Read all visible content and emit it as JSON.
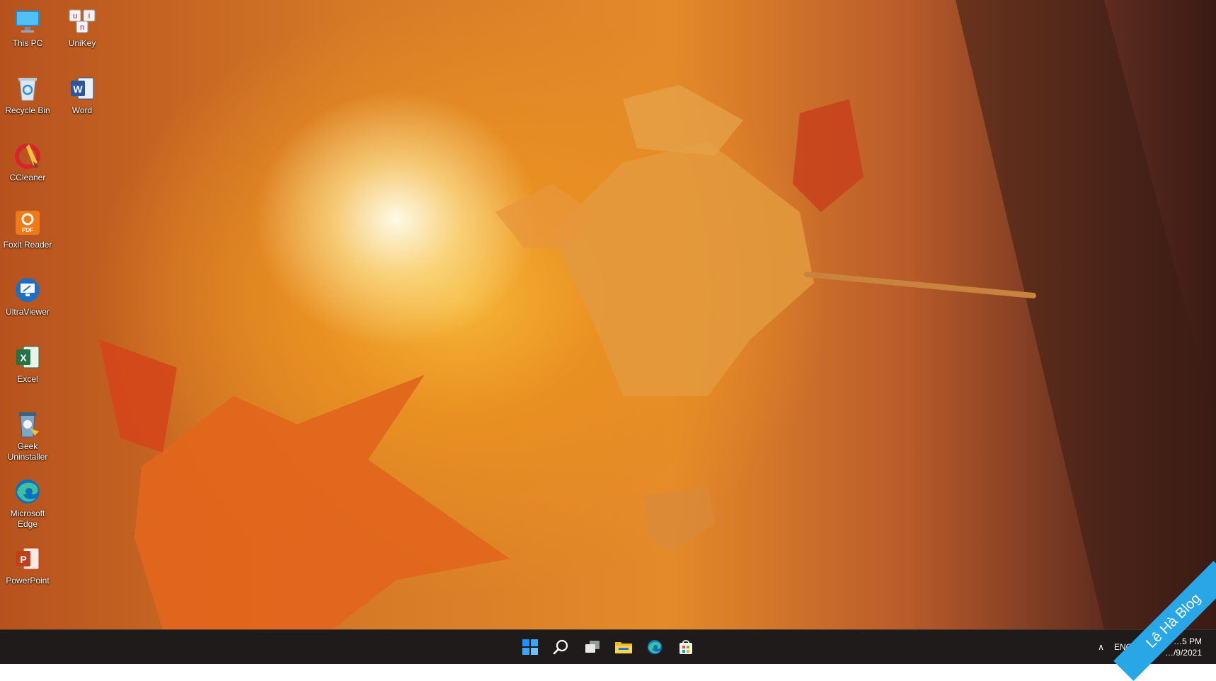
{
  "desktop": {
    "icons": [
      {
        "label": "This PC",
        "icon": "monitor-icon"
      },
      {
        "label": "UniKey",
        "icon": "unikey-icon"
      },
      {
        "label": "Recycle Bin",
        "icon": "recycle-bin-icon"
      },
      {
        "label": "Word",
        "icon": "word-icon"
      },
      {
        "label": "CCleaner",
        "icon": "ccleaner-icon"
      },
      {
        "label": "Foxit Reader",
        "icon": "foxit-reader-icon"
      },
      {
        "label": "UltraViewer",
        "icon": "ultraviewer-icon"
      },
      {
        "label": "Excel",
        "icon": "excel-icon"
      },
      {
        "label": "Geek\nUninstaller",
        "icon": "geek-uninstaller-icon"
      },
      {
        "label": "Microsoft\nEdge",
        "icon": "edge-icon"
      },
      {
        "label": "PowerPoint",
        "icon": "powerpoint-icon"
      }
    ]
  },
  "taskbar": {
    "apps": [
      "start-icon",
      "search-icon",
      "task-view-icon",
      "file-explorer-icon",
      "edge-icon",
      "store-icon"
    ],
    "tray": {
      "chevron": "chevron-up-icon",
      "language": "ENG",
      "time": "…5 PM",
      "date": "…/9/2021"
    }
  },
  "watermark": {
    "text": "Lê Hà Blog"
  },
  "colors": {
    "taskbar": "#1e1b1a",
    "watermark": "#29a6e6",
    "accent": "#0078d4"
  }
}
